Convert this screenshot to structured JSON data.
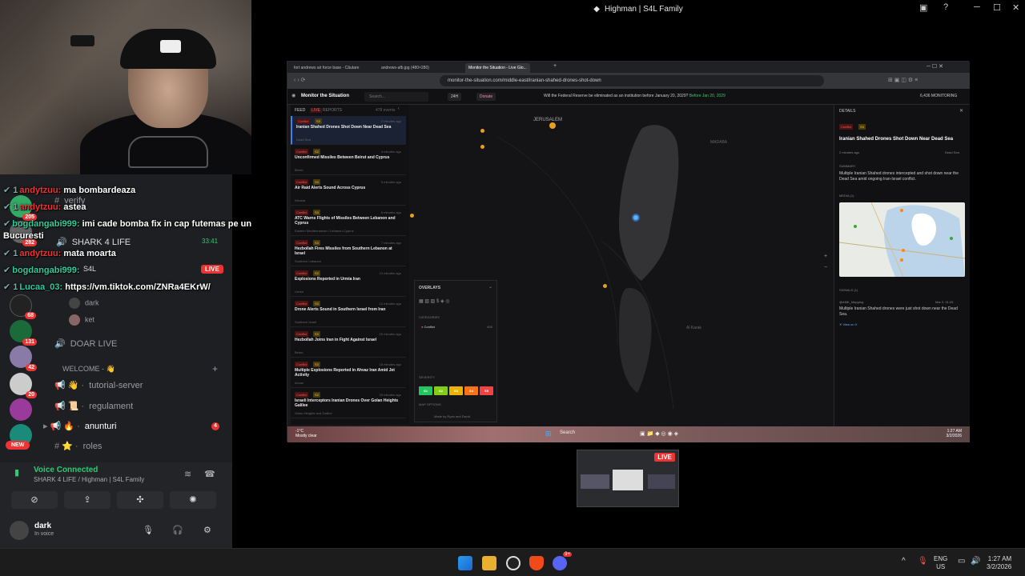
{
  "window": {
    "title": "Highman | S4L Family"
  },
  "chat": [
    {
      "user": "andytzuu:",
      "text": "ma bombardeaza",
      "color": "red"
    },
    {
      "user": "andytzuu:",
      "text": "astea",
      "color": "red"
    },
    {
      "user": "bogdangabi999:",
      "text": "imi cade bomba fix in cap futemas pe un",
      "color": "green"
    },
    {
      "user": "",
      "text": "Bucuresti",
      "color": "none"
    },
    {
      "user": "andytzuu:",
      "text": "mata moarta",
      "color": "red"
    },
    {
      "user": "bogdangabi999:",
      "text": "",
      "color": "green"
    },
    {
      "user": "Lucaa_03:",
      "text": "https://vm.tiktok.com/ZNRa4EKrW/",
      "color": "green"
    }
  ],
  "discord": {
    "channels": {
      "verify": "verify",
      "shark": "SHARK 4 LIFE",
      "shark_time": "33:41",
      "s4l": "S4L",
      "live": "LIVE",
      "member1": "dark",
      "member2": "ket",
      "doar_live": "DOAR LIVE",
      "welcome": "WELCOME -",
      "tutorial": "tutorial-server",
      "regulament": "regulament",
      "anunturi": "anunturi",
      "anunturi_count": "4",
      "roles": "roles"
    },
    "servers": [
      {
        "count": "205"
      },
      {
        "count": "282"
      },
      {
        "count": "68"
      },
      {
        "count": "131"
      },
      {
        "count": "42"
      },
      {
        "count": "20"
      }
    ],
    "new_badge": "NEW",
    "voice": {
      "status": "Voice Connected",
      "channel": "SHARK 4 LIFE / Highman | S4L Family"
    },
    "user": {
      "name": "dark",
      "status": "In voice"
    }
  },
  "browser": {
    "tabs": [
      "fort andrews air force base - Căutare",
      "andrews-afb.jpg (480×280)",
      "Monitor the Situation - Live Glo..."
    ],
    "url": "monitor-the-situation.com/middle-east/iranian-shahed-drones-shot-down",
    "site": {
      "name": "Monitor the Situation",
      "search_placeholder": "Search...",
      "range": "24H",
      "donate": "Donate",
      "ticker": "Will the Federal Reserve be eliminated as an institution before January 20, 2029?",
      "ticker_time": "Before Jan 20, 2029",
      "counter": "6,436 MONITORING"
    },
    "feed": {
      "header": "FEED",
      "live": "LIVE",
      "reports": "REPORTS",
      "count": "478 events",
      "items": [
        {
          "tag": "Conflict",
          "sev": "S3",
          "time": "2 minutes ago",
          "title": "Iranian Shahed Drones Shot Down Near Dead Sea",
          "loc": "Dead Sea"
        },
        {
          "tag": "Conflict",
          "sev": "S3",
          "time": "4 minutes ago",
          "title": "Unconfirmed Missiles Between Beirut and Cyprus",
          "loc": "Beirut"
        },
        {
          "tag": "Conflict",
          "sev": "S3",
          "time": "5 minutes ago",
          "title": "Air Raid Alerts Sound Across Cyprus",
          "loc": "Nicosia"
        },
        {
          "tag": "Conflict",
          "sev": "S3",
          "time": "6 minutes ago",
          "title": "ATC Warns Flights of Missiles Between Lebanon and Cyprus",
          "loc": "Eastern Mediterranean / Lebanon-Cyprus"
        },
        {
          "tag": "Conflict",
          "sev": "S3",
          "time": "7 minutes ago",
          "title": "Hezbollah Fires Missiles from Southern Lebanon at Israel",
          "loc": "Southern Lebanon"
        },
        {
          "tag": "Conflict",
          "sev": "S3",
          "time": "10 minutes ago",
          "title": "Explosions Reported in Urmia Iran",
          "loc": "Urmia"
        },
        {
          "tag": "Conflict",
          "sev": "S3",
          "time": "12 minutes ago",
          "title": "Drone Alerts Sound in Southern Israel from Iran",
          "loc": "Southern Israel"
        },
        {
          "tag": "Conflict",
          "sev": "S3",
          "time": "15 minutes ago",
          "title": "Hezbollah Joins Iran in Fight Against Israel",
          "loc": "Beirut"
        },
        {
          "tag": "Conflict",
          "sev": "S3",
          "time": "18 minutes ago",
          "title": "Multiple Explosions Reported in Ahvaz Iran Amid Jet Activity",
          "loc": "Ahvaz"
        },
        {
          "tag": "Conflict",
          "sev": "S3",
          "time": "20 minutes ago",
          "title": "Israeli Interceptors Iranian Drones Over Golan Heights Galilee",
          "loc": "Golan Heights and Galilee"
        }
      ]
    },
    "map": {
      "labels": {
        "jerusalem": "JERUSALEM",
        "madaba": "MADABA",
        "al_karak": "Al Karak"
      }
    },
    "overlays": {
      "title": "OVERLAYS",
      "categories": "CATEGORIES",
      "conflict": "Conflict",
      "conflict_count": "408",
      "severity": "SEVERITY",
      "sev_labels": [
        "S1",
        "S2",
        "S3",
        "S4",
        "S5"
      ],
      "sev_colors": [
        "#22c55e",
        "#84cc16",
        "#eab308",
        "#f97316",
        "#ef4444"
      ],
      "map_options": "MAP OPTIONS",
      "credit": "Made by Ryan and David"
    },
    "details": {
      "header": "DETAILS",
      "tag": "Conflict",
      "sev": "S3",
      "title": "Iranian Shahed Drones Shot Down Near Dead Sea",
      "time": "2 minutes ago",
      "location": "Dead Sea",
      "summary_label": "SUMMARY",
      "summary": "Multiple Iranian Shahed drones intercepted and shot down near the Dead Sea amid ongoing Iran-Israel conflict.",
      "media_label": "MEDIA (1)",
      "signals_label": "SIGNALS (1)",
      "signal_user": "@AMK_Mapping",
      "signal_date": "Mar 2, 01:25",
      "signal_text": "Multiple Iranian Shahed drones were just shot down near the Dead Sea.",
      "view_on_x": "View on X"
    },
    "inner_taskbar": {
      "weather_temp": "-1°C",
      "weather": "Mostly clear",
      "search": "Search",
      "time": "1:27 AM",
      "date": "3/2/2026"
    }
  },
  "preview": {
    "live": "LIVE"
  },
  "taskbar": {
    "lang1": "ENG",
    "lang2": "US",
    "time": "1:27 AM",
    "date": "3/2/2026",
    "discord_badge": "9+"
  }
}
